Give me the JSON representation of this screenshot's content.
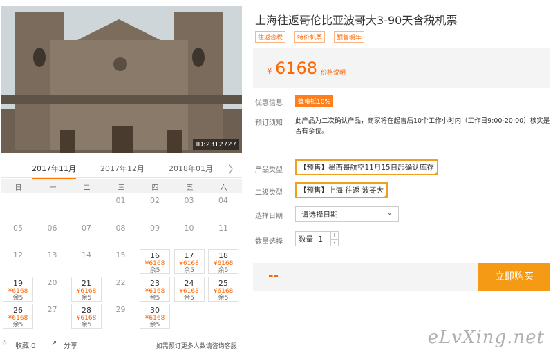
{
  "photo": {
    "id_label": "ID:2312727"
  },
  "calendar": {
    "tabs": [
      "2017年11月",
      "2017年12月",
      "2018年01月"
    ],
    "next_arrow": "〉",
    "weekdays": [
      "日",
      "一",
      "二",
      "三",
      "四",
      "五",
      "六"
    ],
    "days": [
      {
        "d": "01",
        "col": 3,
        "row": 0
      },
      {
        "d": "02",
        "col": 4,
        "row": 0
      },
      {
        "d": "03",
        "col": 5,
        "row": 0
      },
      {
        "d": "04",
        "col": 6,
        "row": 0
      },
      {
        "d": "05",
        "col": 0,
        "row": 1
      },
      {
        "d": "06",
        "col": 1,
        "row": 1
      },
      {
        "d": "07",
        "col": 2,
        "row": 1
      },
      {
        "d": "08",
        "col": 3,
        "row": 1
      },
      {
        "d": "09",
        "col": 4,
        "row": 1
      },
      {
        "d": "10",
        "col": 5,
        "row": 1
      },
      {
        "d": "11",
        "col": 6,
        "row": 1
      },
      {
        "d": "12",
        "col": 0,
        "row": 2
      },
      {
        "d": "13",
        "col": 1,
        "row": 2
      },
      {
        "d": "14",
        "col": 2,
        "row": 2
      },
      {
        "d": "15",
        "col": 3,
        "row": 2
      },
      {
        "d": "16",
        "col": 4,
        "row": 2,
        "price": "¥6168",
        "remain": "余5"
      },
      {
        "d": "17",
        "col": 5,
        "row": 2,
        "price": "¥6168",
        "remain": "余5"
      },
      {
        "d": "18",
        "col": 6,
        "row": 2,
        "price": "¥6168",
        "remain": "余5"
      },
      {
        "d": "19",
        "col": 0,
        "row": 3,
        "price": "¥6168",
        "remain": "余5"
      },
      {
        "d": "20",
        "col": 1,
        "row": 3
      },
      {
        "d": "21",
        "col": 2,
        "row": 3,
        "price": "¥6168",
        "remain": "余5"
      },
      {
        "d": "22",
        "col": 3,
        "row": 3
      },
      {
        "d": "23",
        "col": 4,
        "row": 3,
        "price": "¥6168",
        "remain": "余5"
      },
      {
        "d": "24",
        "col": 5,
        "row": 3,
        "price": "¥6168",
        "remain": "余5"
      },
      {
        "d": "25",
        "col": 6,
        "row": 3,
        "price": "¥6168",
        "remain": "余5"
      },
      {
        "d": "26",
        "col": 0,
        "row": 4,
        "price": "¥6168",
        "remain": "余5"
      },
      {
        "d": "27",
        "col": 1,
        "row": 4
      },
      {
        "d": "28",
        "col": 2,
        "row": 4,
        "price": "¥6168",
        "remain": "余5"
      },
      {
        "d": "29",
        "col": 3,
        "row": 4
      },
      {
        "d": "30",
        "col": 4,
        "row": 4,
        "price": "¥6168",
        "remain": "余5"
      }
    ]
  },
  "footer": {
    "favorite": "收藏 0",
    "share": "分享",
    "note": "· 如需预订更多人数请咨询客服"
  },
  "product": {
    "title": "上海往返哥伦比亚波哥大3-90天含税机票",
    "tags": [
      "往返含税",
      "特价机票",
      "预售明年"
    ],
    "currency": "¥",
    "price": "6168",
    "price_note": "价格说明",
    "promo_label": "优惠信息",
    "promo_badge": "蜂蜜抵10%",
    "notice_label": "预订须知",
    "notice_text": "此产品为二次确认产品，商家将在起售后10个工作小时内（工作日9:00-20:00）核实是否有余位。",
    "type_label": "产品类型",
    "type_value": "【预售】墨西哥航空11月15日起确认库存",
    "sub_label": "二级类型",
    "sub_value": "【预售】上海 往返 波哥大",
    "date_label": "选择日期",
    "date_placeholder": "请选择日期",
    "qty_label": "数量选择",
    "qty_text": "数量",
    "qty_value": "1",
    "total": "--",
    "buy": "立即购买"
  },
  "watermark": "eLvXing.net",
  "colors": {
    "accent": "#ff6600",
    "buy_button": "#f49a15",
    "option_border": "#f0a020"
  }
}
